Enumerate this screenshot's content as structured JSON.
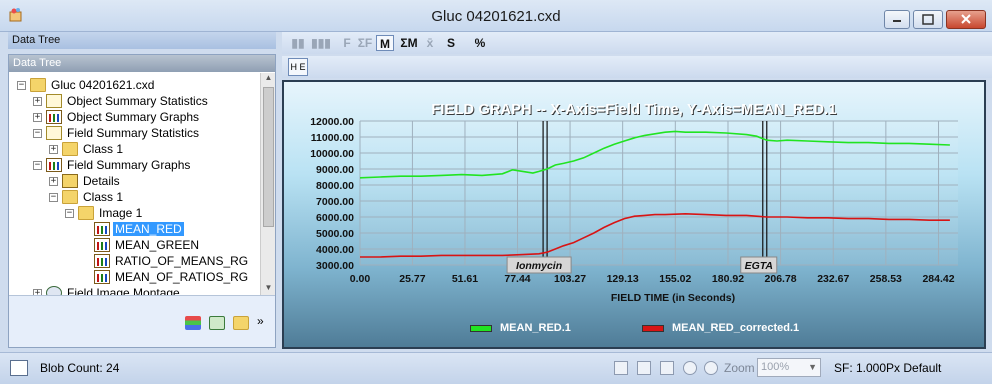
{
  "window": {
    "title": "Gluc 04201621.cxd"
  },
  "left_panel": {
    "top_header": "Data Tree",
    "header": "Data Tree",
    "tree": [
      {
        "label": "Gluc 04201621.cxd",
        "expander": "−",
        "icon": "folder-icon",
        "level": 0
      },
      {
        "label": "Object Summary Statistics",
        "expander": "+",
        "icon": "statistics-icon",
        "level": 1
      },
      {
        "label": "Object Summary Graphs",
        "expander": "+",
        "icon": "graph-icon",
        "level": 1
      },
      {
        "label": "Field Summary Statistics",
        "expander": "−",
        "icon": "statistics-icon",
        "level": 1
      },
      {
        "label": "Class 1",
        "expander": "+",
        "icon": "folder-icon",
        "level": 2
      },
      {
        "label": "Field Summary Graphs",
        "expander": "−",
        "icon": "graph-icon",
        "level": 1
      },
      {
        "label": "Details",
        "expander": "+",
        "icon": "details-icon",
        "level": 2
      },
      {
        "label": "Class 1",
        "expander": "−",
        "icon": "folder-icon",
        "level": 2
      },
      {
        "label": "Image 1",
        "expander": "−",
        "icon": "folder-icon",
        "level": 3
      },
      {
        "label": "MEAN_RED",
        "expander": "",
        "icon": "graph-icon",
        "level": 4,
        "selected": true
      },
      {
        "label": "MEAN_GREEN",
        "expander": "",
        "icon": "graph-icon",
        "level": 4
      },
      {
        "label": "RATIO_OF_MEANS_RG",
        "expander": "",
        "icon": "graph-icon",
        "level": 4
      },
      {
        "label": "MEAN_OF_RATIOS_RG",
        "expander": "",
        "icon": "graph-icon",
        "level": 4
      },
      {
        "label": "Field Image Montage",
        "expander": "+",
        "icon": "montage-icon",
        "level": 1
      }
    ],
    "footer_more": "»"
  },
  "toolbar": {
    "buttons": [
      {
        "label": "▮▮",
        "name": "bar-chart-icon",
        "active": false
      },
      {
        "label": "▮▮▮",
        "name": "bar-chart-2-icon",
        "active": false
      },
      {
        "label": "F",
        "name": "f-button",
        "active": false
      },
      {
        "label": "ΣF",
        "name": "sum-f-button",
        "active": false
      },
      {
        "label": "M",
        "name": "m-button",
        "active": true,
        "pressed": true
      },
      {
        "label": "ΣM",
        "name": "sum-m-button",
        "active": true
      },
      {
        "label": "x̄",
        "name": "mean-button",
        "active": false
      },
      {
        "label": "S",
        "name": "s-button",
        "active": true
      },
      {
        "label": "%",
        "name": "percent-button",
        "active": true
      }
    ],
    "grid_button": "H E"
  },
  "status": {
    "blob_count": "Blob Count: 24",
    "zoom_label": "Zoom",
    "zoom_value": "100%",
    "sf_text": "SF: 1.000Px  Default"
  },
  "colors": {
    "series_green": "#21e421",
    "series_red": "#d81414"
  },
  "chart_data": {
    "type": "line",
    "title": "FIELD GRAPH -- X-Axis=Field Time, Y-Axis=MEAN_RED.1",
    "xlabel": "FIELD TIME (in Seconds)",
    "ylabel": "",
    "x_ticks": [
      "0.00",
      "25.77",
      "51.61",
      "77.44",
      "103.27",
      "129.13",
      "155.02",
      "180.92",
      "206.78",
      "232.67",
      "258.53",
      "284.42"
    ],
    "y_ticks": [
      "3000.00",
      "4000.00",
      "5000.00",
      "6000.00",
      "7000.00",
      "8000.00",
      "9000.00",
      "10000.00",
      "11000.00",
      "12000.00"
    ],
    "xlim": [
      0,
      294
    ],
    "ylim": [
      3000,
      12000
    ],
    "grid": true,
    "legend_placement": "bottom",
    "annotations": [
      {
        "label": "Ionmycin",
        "x": 91
      },
      {
        "label": "EGTA",
        "x": 199
      }
    ],
    "series": [
      {
        "name": "MEAN_RED.1",
        "color": "#21e421",
        "x": [
          0,
          10,
          20,
          30,
          40,
          50,
          60,
          70,
          75,
          80,
          85,
          88,
          92,
          96,
          100,
          105,
          110,
          115,
          120,
          125,
          130,
          135,
          140,
          145,
          150,
          155,
          160,
          170,
          180,
          190,
          195,
          200,
          205,
          210,
          220,
          230,
          240,
          250,
          260,
          270,
          280,
          290
        ],
        "y": [
          8450,
          8500,
          8550,
          8550,
          8600,
          8650,
          8600,
          8700,
          8950,
          8850,
          8750,
          8850,
          9000,
          9250,
          9350,
          9500,
          9700,
          10000,
          10300,
          10550,
          10750,
          10950,
          11100,
          11200,
          11300,
          11350,
          11300,
          11300,
          11250,
          11150,
          11050,
          10800,
          10750,
          10800,
          10750,
          10700,
          10650,
          10650,
          10600,
          10600,
          10550,
          10500
        ]
      },
      {
        "name": "MEAN_RED_corrected.1",
        "color": "#d81414",
        "x": [
          0,
          10,
          20,
          30,
          40,
          50,
          60,
          70,
          80,
          88,
          92,
          96,
          100,
          105,
          110,
          115,
          120,
          125,
          130,
          135,
          140,
          145,
          150,
          160,
          170,
          180,
          190,
          200,
          210,
          220,
          230,
          240,
          250,
          260,
          270,
          280,
          290
        ],
        "y": [
          3500,
          3500,
          3550,
          3550,
          3600,
          3600,
          3600,
          3600,
          3650,
          3700,
          3800,
          4000,
          4200,
          4400,
          4700,
          5000,
          5350,
          5650,
          5900,
          6050,
          6100,
          6150,
          6150,
          6200,
          6150,
          6100,
          6100,
          6000,
          6000,
          5950,
          5950,
          5900,
          5900,
          5850,
          5850,
          5800,
          5800
        ]
      }
    ]
  }
}
